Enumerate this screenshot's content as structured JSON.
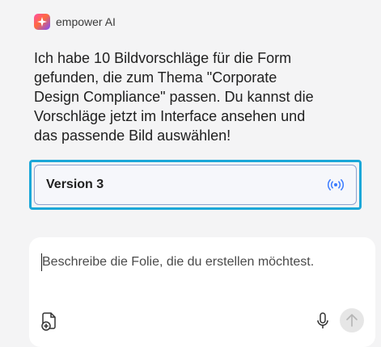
{
  "assistant": {
    "name": "empower AI",
    "logo_icon": "sparkle-logo-icon"
  },
  "message": {
    "text": "Ich habe 10 Bildvorschläge für die Form gefunden, die zum Thema \"Corporate Design Compliance\" passen. Du kannst die Vorschläge jetzt im Interface ansehen und das passende Bild auswählen!"
  },
  "version_card": {
    "label": "Version 3",
    "icon": "broadcast-icon"
  },
  "composer": {
    "placeholder": "Beschreibe die Folie, die du erstellen möchtest.",
    "value": "",
    "attach_icon": "attach-file-icon",
    "mic_icon": "microphone-icon",
    "send_icon": "send-arrow-icon"
  },
  "colors": {
    "accent": "#1aa7d8",
    "card_border": "#8fa2cf",
    "background": "#f4f4f5"
  }
}
